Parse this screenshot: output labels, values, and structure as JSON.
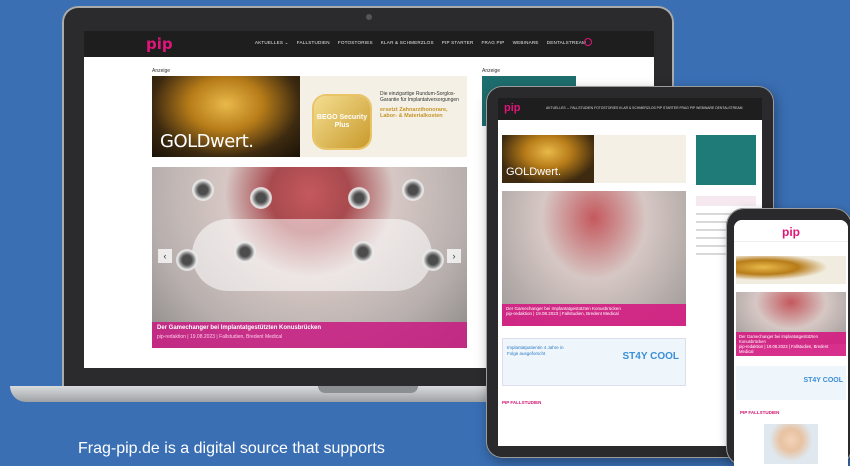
{
  "laptop": {
    "logo": "pip",
    "nav": [
      "AKTUELLES ⌄",
      "FALLSTUDIEN",
      "FOTOSTORIES",
      "KLAR & SCHMERZLOS",
      "PIP STARTER",
      "FRAG PIP",
      "WEBINARE",
      "DENTALSTREAM"
    ],
    "ad_label": "Anzeige",
    "side_ad_label": "Anzeige",
    "ad": {
      "gold_text": "GOLDwert.",
      "seal": "BEGO Security Plus",
      "copy": "Die einzigartige Rundum-Sorglos-Garantie für Implantatversorgungen",
      "highlight": "ersetzt Zahnarzthonorare, Labor- & Materialkosten"
    },
    "hero": {
      "title": "Der Gamechanger bei Implantatgestützten Konusbrücken",
      "meta": "pip-redaktion | 19.08.2023 | Fallstudien, Bredent Medical"
    }
  },
  "tablet": {
    "logo": "pip",
    "nav": "AKTUELLES ⌄   FALLSTUDIEN   FOTOSTORIES   KLAR & SCHMERZLOS   PIP STARTER   FRAG PIP   WEBINARE   DENTALSTREAM",
    "ad_gold_text": "GOLDwert.",
    "hero_title": "Der Gamechanger bei Implantatgestützten Konusbrücken",
    "hero_meta": "pip-redaktion | 19.08.2023 | Fallstudien, Bredent Medical",
    "ad2_text": "Implantatpatientin 4 Jahre in Folge ausgeforscht",
    "ad2_brand": "ST4Y COOL",
    "section": "PIP FALLSTUDIEN"
  },
  "phone": {
    "logo": "pip",
    "caption_title": "Der Gamechanger bei Implantatgestützten Konusbrücken",
    "caption_meta": "pip-redaktion | 19.08.2023 | Fallstudien, Bredent Medical",
    "ad2_brand": "ST4Y COOL",
    "section": "PIP FALLSTUDIEN"
  },
  "tagline": "Frag-pip.de is a digital source that supports",
  "colors": {
    "background": "#3a6fb4",
    "brand_pink": "#e0157a",
    "nav_dark": "#1e1e1e"
  }
}
